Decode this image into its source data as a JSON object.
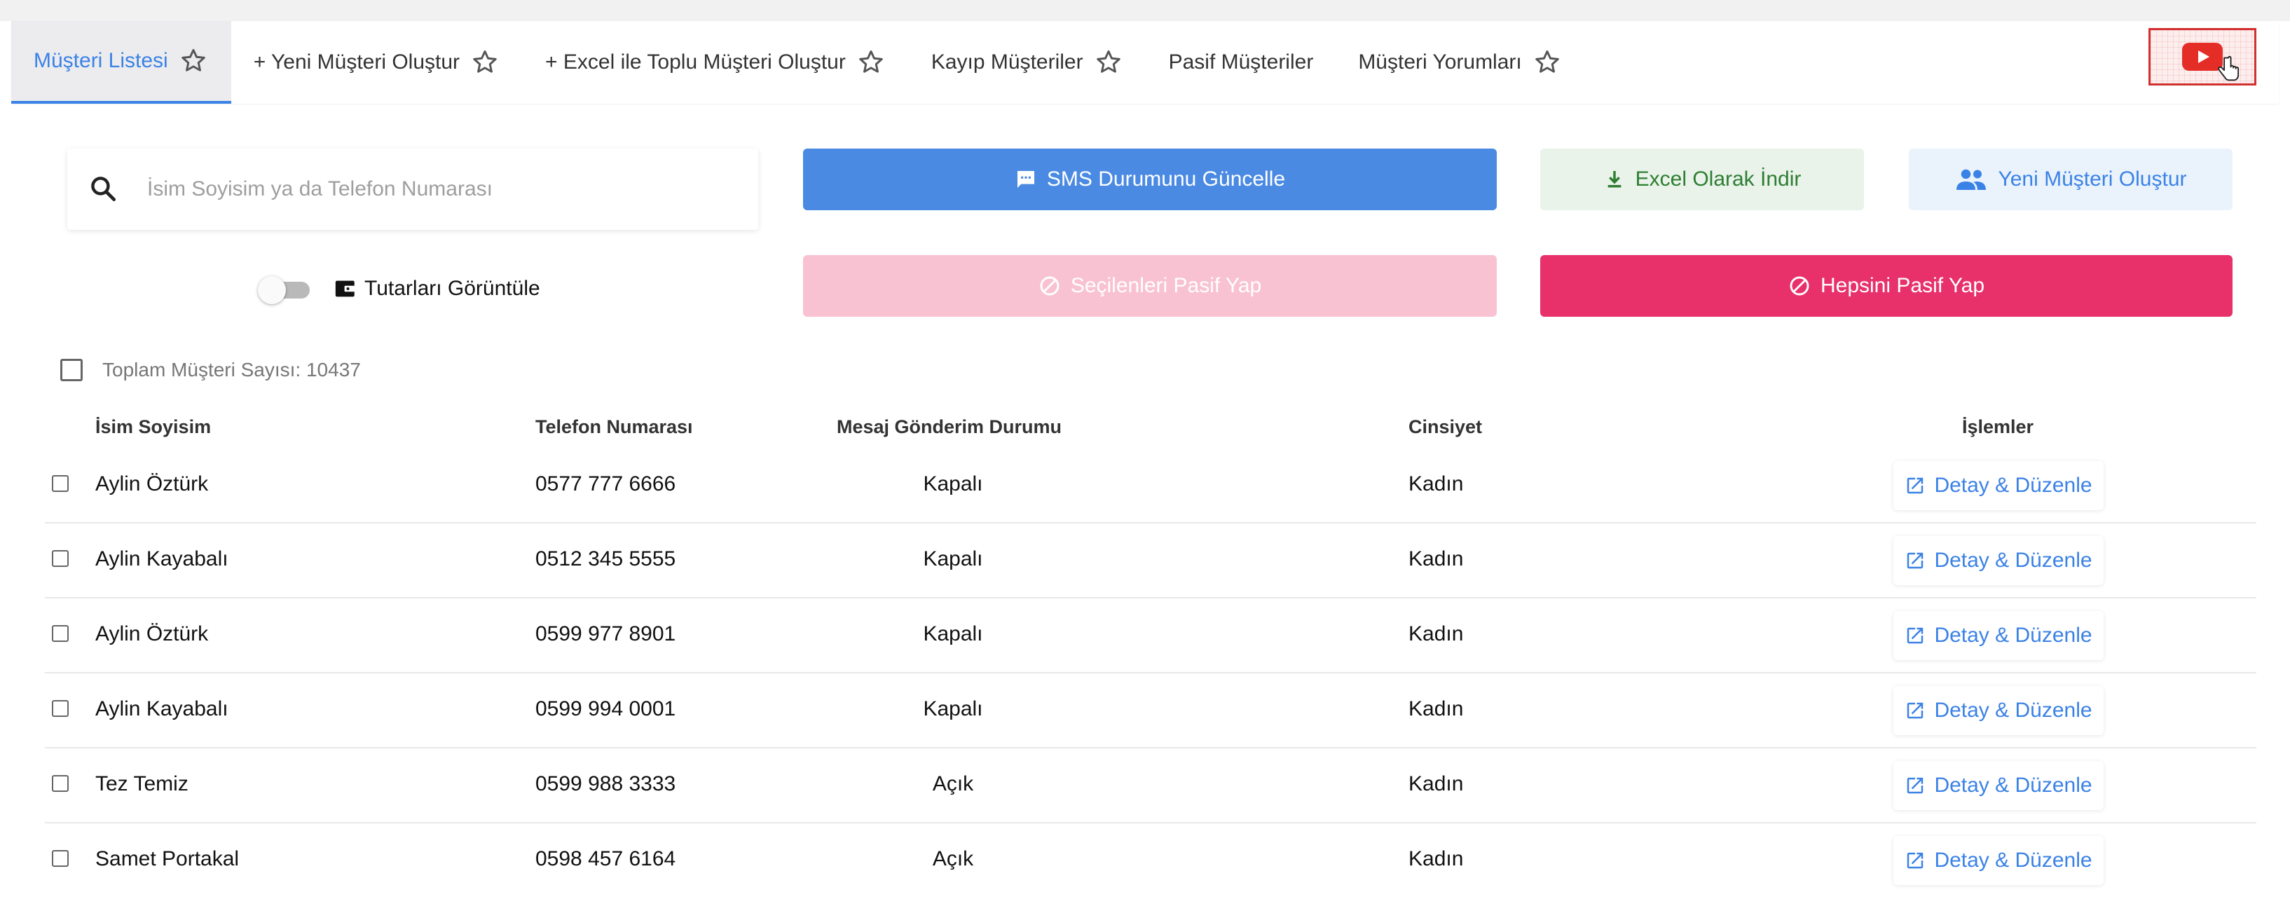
{
  "tabs": [
    {
      "label": "Müşteri Listesi",
      "active": true,
      "star": true
    },
    {
      "label": "+ Yeni Müşteri Oluştur",
      "active": false,
      "star": true
    },
    {
      "label": "+ Excel ile Toplu Müşteri Oluştur",
      "active": false,
      "star": true
    },
    {
      "label": "Kayıp Müşteriler",
      "active": false,
      "star": true
    },
    {
      "label": "Pasif Müşteriler",
      "active": false,
      "star": false
    },
    {
      "label": "Müşteri Yorumları",
      "active": false,
      "star": true
    }
  ],
  "video_button": {
    "icon": "youtube-icon"
  },
  "search": {
    "placeholder": "İsim Soyisim ya da Telefon Numarası",
    "value": ""
  },
  "buttons": {
    "sms_update": "SMS Durumunu Güncelle",
    "excel_download": "Excel Olarak İndir",
    "new_customer": "Yeni Müşteri Oluştur",
    "make_selected_passive": "Seçilenleri Pasif Yap",
    "make_all_passive": "Hepsini Pasif Yap"
  },
  "toggle": {
    "label": "Tutarları Görüntüle",
    "on": false
  },
  "total": {
    "label": "Toplam Müşteri Sayısı: 10437"
  },
  "table": {
    "headers": {
      "name": "İsim Soyisim",
      "phone": "Telefon Numarası",
      "message_status": "Mesaj Gönderim Durumu",
      "gender": "Cinsiyet",
      "actions": "İşlemler"
    },
    "rows": [
      {
        "name": "Aylin Öztürk",
        "phone": "0577 777 6666",
        "message_status": "Kapalı",
        "gender": "Kadın",
        "action": "Detay & Düzenle"
      },
      {
        "name": "Aylin Kayabalı",
        "phone": "0512 345 5555",
        "message_status": "Kapalı",
        "gender": "Kadın",
        "action": "Detay & Düzenle"
      },
      {
        "name": "Aylin Öztürk",
        "phone": "0599 977 8901",
        "message_status": "Kapalı",
        "gender": "Kadın",
        "action": "Detay & Düzenle"
      },
      {
        "name": "Aylin Kayabalı",
        "phone": "0599 994 0001",
        "message_status": "Kapalı",
        "gender": "Kadın",
        "action": "Detay & Düzenle"
      },
      {
        "name": "Tez Temiz",
        "phone": "0599 988 3333",
        "message_status": "Açık",
        "gender": "Kadın",
        "action": "Detay & Düzenle"
      },
      {
        "name": "Samet Portakal",
        "phone": "0598 457 6164",
        "message_status": "Açık",
        "gender": "Kadın",
        "action": "Detay & Düzenle"
      }
    ]
  },
  "colors": {
    "primary": "#4a8ae3",
    "link": "#3b82e6",
    "success_bg": "#e9f3ea",
    "success_text": "#2e7d32",
    "danger": "#e8306a",
    "danger_light": "#f9c2d2"
  }
}
